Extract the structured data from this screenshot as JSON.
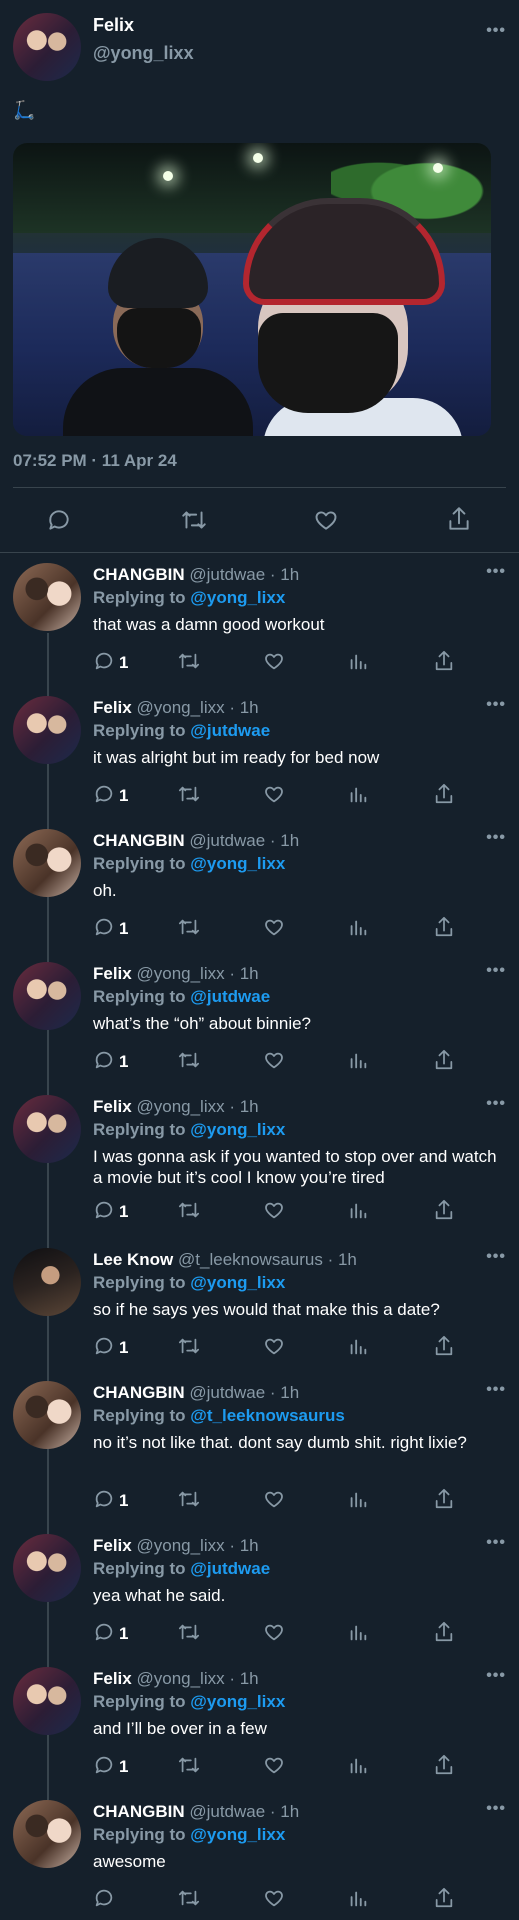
{
  "tweet": {
    "name": "Felix",
    "handle": "@yong_lixx",
    "body_emoji": "🛴",
    "timestamp": "07:52 PM · 11 Apr 24",
    "more": "•••"
  },
  "colors": {
    "background": "#15202b",
    "muted": "#8899a6",
    "link": "#1d9bf0",
    "divider": "#38444d"
  },
  "icons": {
    "reply": "reply-icon",
    "retweet": "retweet-icon",
    "like": "heart-icon",
    "views": "views-icon",
    "share": "share-icon",
    "more": "more-icon"
  },
  "replies": [
    {
      "name": "CHANGBIN",
      "meta": "@jutdwae · 1h",
      "replying_label": "Replying to",
      "replying_to": "@yong_lixx",
      "text": "that was a damn good workout",
      "reply_count": "1",
      "avatar": "changbin",
      "more": "•••"
    },
    {
      "name": "Felix",
      "meta": "@yong_lixx · 1h",
      "replying_label": "Replying to",
      "replying_to": "@jutdwae",
      "text": "it was alright but im ready for bed now",
      "reply_count": "1",
      "avatar": "felix",
      "more": "•••"
    },
    {
      "name": "CHANGBIN",
      "meta": "@jutdwae · 1h",
      "replying_label": "Replying to",
      "replying_to": "@yong_lixx",
      "text": "oh.",
      "reply_count": "1",
      "avatar": "changbin",
      "more": "•••"
    },
    {
      "name": "Felix",
      "meta": "@yong_lixx · 1h",
      "replying_label": "Replying to",
      "replying_to": "@jutdwae",
      "text": "what’s the “oh” about binnie?",
      "reply_count": "1",
      "avatar": "felix",
      "more": "•••"
    },
    {
      "name": "Felix",
      "meta": "@yong_lixx · 1h",
      "replying_label": "Replying to",
      "replying_to": "@yong_lixx",
      "text": "I was gonna ask if you wanted to stop over and watch a movie but it’s cool I know you’re tired",
      "reply_count": "1",
      "avatar": "felix",
      "more": "•••"
    },
    {
      "name": "Lee Know",
      "meta": "@t_leeknowsaurus · 1h",
      "replying_label": "Replying to",
      "replying_to": "@yong_lixx",
      "text": "so if he says yes would that make this a date?",
      "reply_count": "1",
      "avatar": "leeknow",
      "more": "•••"
    },
    {
      "name": "CHANGBIN",
      "meta": "@jutdwae · 1h",
      "replying_label": "Replying to",
      "replying_to": "@t_leeknowsaurus",
      "text": "no it’s not like that. dont say dumb shit. right lixie?",
      "reply_count": "1",
      "avatar": "changbin",
      "more": "•••"
    },
    {
      "name": "Felix",
      "meta": "@yong_lixx · 1h",
      "replying_label": "Replying to",
      "replying_to": "@jutdwae",
      "text": "yea what he said.",
      "reply_count": "1",
      "avatar": "felix",
      "more": "•••"
    },
    {
      "name": "Felix",
      "meta": "@yong_lixx · 1h",
      "replying_label": "Replying to",
      "replying_to": "@yong_lixx",
      "text": "and I’ll be over in a few",
      "reply_count": "1",
      "avatar": "felix",
      "more": "•••"
    },
    {
      "name": "CHANGBIN",
      "meta": "@jutdwae · 1h",
      "replying_label": "Replying to",
      "replying_to": "@yong_lixx",
      "text": "awesome",
      "reply_count": "",
      "avatar": "changbin",
      "more": "•••"
    }
  ]
}
